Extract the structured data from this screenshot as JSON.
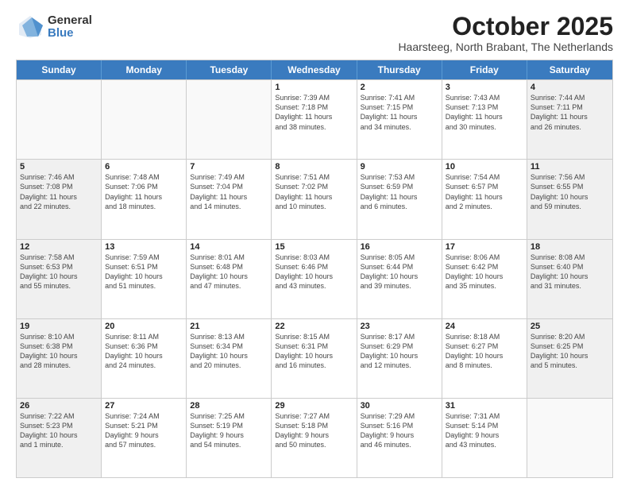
{
  "logo": {
    "general": "General",
    "blue": "Blue"
  },
  "title": {
    "month": "October 2025",
    "location": "Haarsteeg, North Brabant, The Netherlands"
  },
  "calendar": {
    "headers": [
      "Sunday",
      "Monday",
      "Tuesday",
      "Wednesday",
      "Thursday",
      "Friday",
      "Saturday"
    ],
    "weeks": [
      [
        {
          "day": "",
          "info": "",
          "empty": true
        },
        {
          "day": "",
          "info": "",
          "empty": true
        },
        {
          "day": "",
          "info": "",
          "empty": true
        },
        {
          "day": "1",
          "info": "Sunrise: 7:39 AM\nSunset: 7:18 PM\nDaylight: 11 hours\nand 38 minutes."
        },
        {
          "day": "2",
          "info": "Sunrise: 7:41 AM\nSunset: 7:15 PM\nDaylight: 11 hours\nand 34 minutes."
        },
        {
          "day": "3",
          "info": "Sunrise: 7:43 AM\nSunset: 7:13 PM\nDaylight: 11 hours\nand 30 minutes."
        },
        {
          "day": "4",
          "info": "Sunrise: 7:44 AM\nSunset: 7:11 PM\nDaylight: 11 hours\nand 26 minutes.",
          "shaded": true
        }
      ],
      [
        {
          "day": "5",
          "info": "Sunrise: 7:46 AM\nSunset: 7:08 PM\nDaylight: 11 hours\nand 22 minutes.",
          "shaded": true
        },
        {
          "day": "6",
          "info": "Sunrise: 7:48 AM\nSunset: 7:06 PM\nDaylight: 11 hours\nand 18 minutes."
        },
        {
          "day": "7",
          "info": "Sunrise: 7:49 AM\nSunset: 7:04 PM\nDaylight: 11 hours\nand 14 minutes."
        },
        {
          "day": "8",
          "info": "Sunrise: 7:51 AM\nSunset: 7:02 PM\nDaylight: 11 hours\nand 10 minutes."
        },
        {
          "day": "9",
          "info": "Sunrise: 7:53 AM\nSunset: 6:59 PM\nDaylight: 11 hours\nand 6 minutes."
        },
        {
          "day": "10",
          "info": "Sunrise: 7:54 AM\nSunset: 6:57 PM\nDaylight: 11 hours\nand 2 minutes."
        },
        {
          "day": "11",
          "info": "Sunrise: 7:56 AM\nSunset: 6:55 PM\nDaylight: 10 hours\nand 59 minutes.",
          "shaded": true
        }
      ],
      [
        {
          "day": "12",
          "info": "Sunrise: 7:58 AM\nSunset: 6:53 PM\nDaylight: 10 hours\nand 55 minutes.",
          "shaded": true
        },
        {
          "day": "13",
          "info": "Sunrise: 7:59 AM\nSunset: 6:51 PM\nDaylight: 10 hours\nand 51 minutes."
        },
        {
          "day": "14",
          "info": "Sunrise: 8:01 AM\nSunset: 6:48 PM\nDaylight: 10 hours\nand 47 minutes."
        },
        {
          "day": "15",
          "info": "Sunrise: 8:03 AM\nSunset: 6:46 PM\nDaylight: 10 hours\nand 43 minutes."
        },
        {
          "day": "16",
          "info": "Sunrise: 8:05 AM\nSunset: 6:44 PM\nDaylight: 10 hours\nand 39 minutes."
        },
        {
          "day": "17",
          "info": "Sunrise: 8:06 AM\nSunset: 6:42 PM\nDaylight: 10 hours\nand 35 minutes."
        },
        {
          "day": "18",
          "info": "Sunrise: 8:08 AM\nSunset: 6:40 PM\nDaylight: 10 hours\nand 31 minutes.",
          "shaded": true
        }
      ],
      [
        {
          "day": "19",
          "info": "Sunrise: 8:10 AM\nSunset: 6:38 PM\nDaylight: 10 hours\nand 28 minutes.",
          "shaded": true
        },
        {
          "day": "20",
          "info": "Sunrise: 8:11 AM\nSunset: 6:36 PM\nDaylight: 10 hours\nand 24 minutes."
        },
        {
          "day": "21",
          "info": "Sunrise: 8:13 AM\nSunset: 6:34 PM\nDaylight: 10 hours\nand 20 minutes."
        },
        {
          "day": "22",
          "info": "Sunrise: 8:15 AM\nSunset: 6:31 PM\nDaylight: 10 hours\nand 16 minutes."
        },
        {
          "day": "23",
          "info": "Sunrise: 8:17 AM\nSunset: 6:29 PM\nDaylight: 10 hours\nand 12 minutes."
        },
        {
          "day": "24",
          "info": "Sunrise: 8:18 AM\nSunset: 6:27 PM\nDaylight: 10 hours\nand 8 minutes."
        },
        {
          "day": "25",
          "info": "Sunrise: 8:20 AM\nSunset: 6:25 PM\nDaylight: 10 hours\nand 5 minutes.",
          "shaded": true
        }
      ],
      [
        {
          "day": "26",
          "info": "Sunrise: 7:22 AM\nSunset: 5:23 PM\nDaylight: 10 hours\nand 1 minute.",
          "shaded": true
        },
        {
          "day": "27",
          "info": "Sunrise: 7:24 AM\nSunset: 5:21 PM\nDaylight: 9 hours\nand 57 minutes."
        },
        {
          "day": "28",
          "info": "Sunrise: 7:25 AM\nSunset: 5:19 PM\nDaylight: 9 hours\nand 54 minutes."
        },
        {
          "day": "29",
          "info": "Sunrise: 7:27 AM\nSunset: 5:18 PM\nDaylight: 9 hours\nand 50 minutes."
        },
        {
          "day": "30",
          "info": "Sunrise: 7:29 AM\nSunset: 5:16 PM\nDaylight: 9 hours\nand 46 minutes."
        },
        {
          "day": "31",
          "info": "Sunrise: 7:31 AM\nSunset: 5:14 PM\nDaylight: 9 hours\nand 43 minutes."
        },
        {
          "day": "",
          "info": "",
          "empty": true
        }
      ]
    ]
  }
}
